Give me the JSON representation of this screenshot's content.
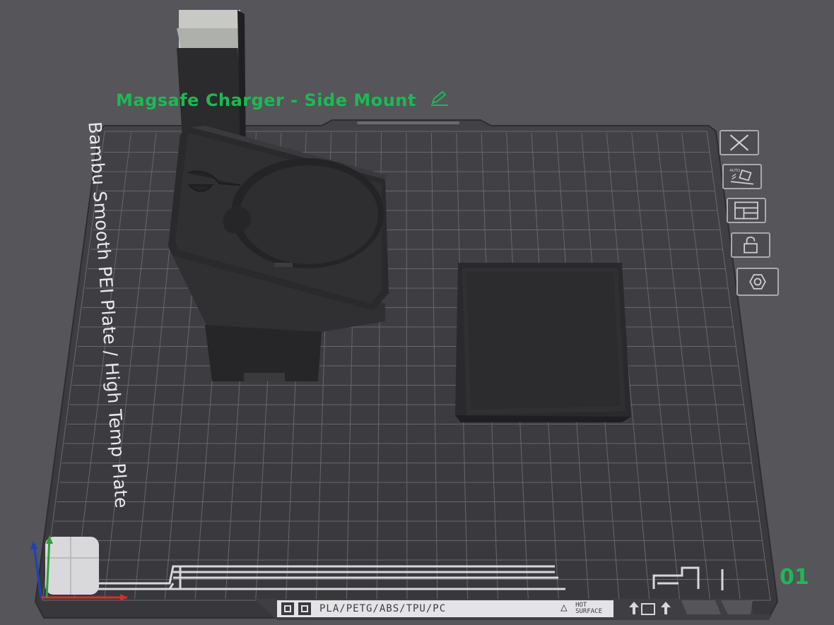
{
  "plate": {
    "title": "Magsafe Charger - Side Mount",
    "edit_icon": "pencil-icon",
    "name": "Bambu Smooth PEI Plate / High Temp Plate",
    "number": "01",
    "materials": "PLA/PETG/ABS/TPU/PC",
    "hot_surface_line1": "HOT",
    "hot_surface_line2": "SURFACE",
    "warning_icon": "warning-triangle-icon"
  },
  "toolbar": {
    "items": [
      {
        "name": "delete-plate-button",
        "icon": "close-icon"
      },
      {
        "name": "auto-orient-button",
        "icon": "auto-orient-icon"
      },
      {
        "name": "arrange-button",
        "icon": "arrange-icon"
      },
      {
        "name": "lock-button",
        "icon": "unlock-icon"
      },
      {
        "name": "plate-settings-button",
        "icon": "hex-nut-icon"
      }
    ]
  },
  "colors": {
    "background": "#55555a",
    "plate": "#3b3b3f",
    "grid": "#6f6f74",
    "accent": "#1db954",
    "model": "#2a2a2c",
    "label": "#e9e9ea"
  }
}
